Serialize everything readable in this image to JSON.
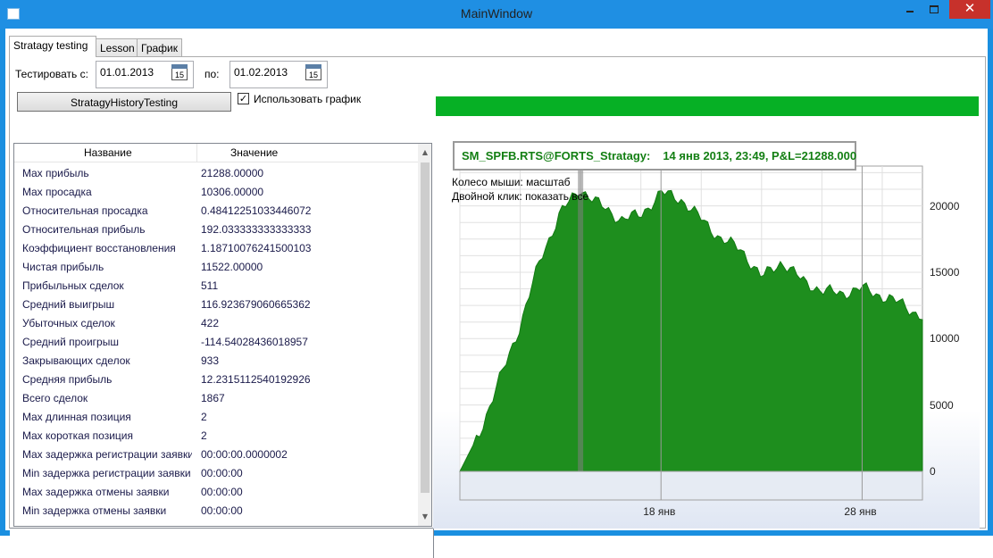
{
  "window": {
    "title": "MainWindow",
    "close_glyph": "✕"
  },
  "tabs": [
    {
      "label": "Stratagy testing",
      "active": true
    },
    {
      "label": "Lesson",
      "active": false
    },
    {
      "label": "График",
      "active": false
    }
  ],
  "controls": {
    "from_label": "Тестировать с:",
    "from_date": "01.01.2013",
    "to_label": "по:",
    "to_date": "01.02.2013",
    "calendar_day": "15",
    "run_button": "StratagyHistoryTesting",
    "use_chart_label": "Использовать график",
    "use_chart_checked": true,
    "check_glyph": "✓"
  },
  "stats": {
    "columns": [
      "Название",
      "Значение"
    ],
    "rows": [
      {
        "name": "Max прибыль",
        "value": "21288.00000"
      },
      {
        "name": "Max просадка",
        "value": "10306.00000"
      },
      {
        "name": "Относительная просадка",
        "value": "0.48412251033446072"
      },
      {
        "name": "Относительная прибыль",
        "value": "192.033333333333333"
      },
      {
        "name": "Коэффициент восстановления",
        "value": "1.18710076241500103"
      },
      {
        "name": "Чистая прибыль",
        "value": "11522.00000"
      },
      {
        "name": "Прибыльных сделок",
        "value": "511"
      },
      {
        "name": "Средний выигрыш",
        "value": "116.923679060665362"
      },
      {
        "name": "Убыточных сделок",
        "value": "422"
      },
      {
        "name": "Средний проигрыш",
        "value": "-114.54028436018957"
      },
      {
        "name": "Закрывающих сделок",
        "value": "933"
      },
      {
        "name": "Средняя прибыль",
        "value": "12.2315112540192926"
      },
      {
        "name": "Всего сделок",
        "value": "1867"
      },
      {
        "name": "Max длинная позиция",
        "value": "2"
      },
      {
        "name": "Max короткая позиция",
        "value": "2"
      },
      {
        "name": "Max задержка регистрации заявки",
        "value": "00:00:00.0000002"
      },
      {
        "name": "Min задержка регистрации заявки",
        "value": "00:00:00"
      },
      {
        "name": "Max задержка отмены заявки",
        "value": "00:00:00"
      },
      {
        "name": "Min задержка отмены заявки",
        "value": "00:00:00"
      }
    ]
  },
  "progress": {
    "value": 1.0,
    "color": "#06b025"
  },
  "chart": {
    "legend_name": "SM_SPFB.RTS@FORTS_Stratagy:",
    "legend_value": "14 янв 2013, 23:49, P&L=21288.000",
    "hint_zoom": "Колесо мыши: масштаб",
    "hint_reset": "Двойной клик: показать все",
    "y_ticks": [
      "20000",
      "15000",
      "10000",
      "5000",
      "0"
    ],
    "x_ticks": [
      "18 янв",
      "28 янв"
    ],
    "fill_color": "#1e8e1e",
    "line_color": "#127a12"
  },
  "chart_data": {
    "type": "area",
    "title": "SM_SPFB.RTS@FORTS_Stratagy",
    "xlabel": "",
    "ylabel": "",
    "x": [
      "2013-01-08",
      "2013-01-09",
      "2013-01-10",
      "2013-01-11",
      "2013-01-12",
      "2013-01-13",
      "2013-01-14",
      "2013-01-15",
      "2013-01-16",
      "2013-01-17",
      "2013-01-18",
      "2013-01-19",
      "2013-01-20",
      "2013-01-21",
      "2013-01-22",
      "2013-01-23",
      "2013-01-24",
      "2013-01-25",
      "2013-01-26",
      "2013-01-27",
      "2013-01-28",
      "2013-01-29",
      "2013-01-30",
      "2013-01-31"
    ],
    "y": [
      0,
      3000,
      7000,
      11000,
      16000,
      19500,
      21288,
      20000,
      19000,
      19300,
      21000,
      20500,
      19000,
      17500,
      16700,
      14600,
      15800,
      14400,
      13600,
      13400,
      13800,
      13200,
      12600,
      11600
    ],
    "ylim": [
      0,
      23000
    ],
    "y_ticks": [
      0,
      5000,
      10000,
      15000,
      20000
    ],
    "x_ticks": [
      "18 янв",
      "28 янв"
    ],
    "grid": true
  }
}
